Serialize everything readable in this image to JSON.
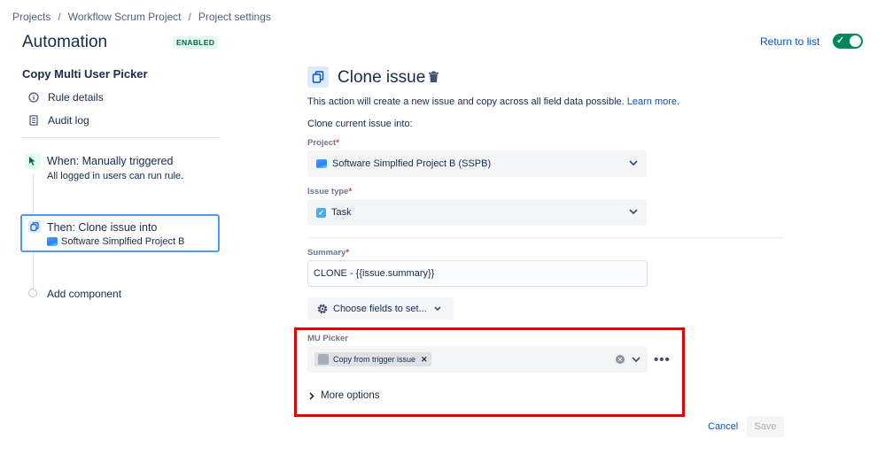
{
  "breadcrumb": {
    "items": [
      "Projects",
      "Workflow Scrum Project",
      "Project settings"
    ],
    "separator": "/"
  },
  "header": {
    "title": "Automation",
    "status_badge": "ENABLED",
    "return_link": "Return to list",
    "toggle_on": true
  },
  "sidebar": {
    "rule_name": "Copy Multi User Picker",
    "items": [
      {
        "label": "Rule details",
        "icon": "info-icon"
      },
      {
        "label": "Audit log",
        "icon": "document-icon"
      }
    ],
    "trigger": {
      "title": "When: Manually triggered",
      "subtitle": "All logged in users can run rule."
    },
    "action": {
      "title": "Then: Clone issue into",
      "subtitle": "Software Simplfied Project B"
    },
    "add_component": "Add component"
  },
  "panel": {
    "title": "Clone issue",
    "description": "This action will create a new issue and copy across all field data possible.",
    "learn_more": "Learn more.",
    "clone_into_label": "Clone current issue into:",
    "project": {
      "label": "Project",
      "required_mark": "*",
      "value": "Software Simplfied Project B (SSPB)"
    },
    "issue_type": {
      "label": "Issue type",
      "required_mark": "*",
      "value": "Task"
    },
    "summary": {
      "label": "Summary",
      "required_mark": "*",
      "value": "CLONE - {{issue.summary}}"
    },
    "choose_fields": "Choose fields to set...",
    "mu_picker": {
      "label": "MU Picker",
      "tag": "Copy from trigger issue"
    },
    "more_options": "More options",
    "cancel": "Cancel",
    "save": "Save"
  },
  "colors": {
    "accent": "#0052CC",
    "toggle": "#00875A",
    "highlight": "#E60000",
    "required": "#DE350B"
  }
}
